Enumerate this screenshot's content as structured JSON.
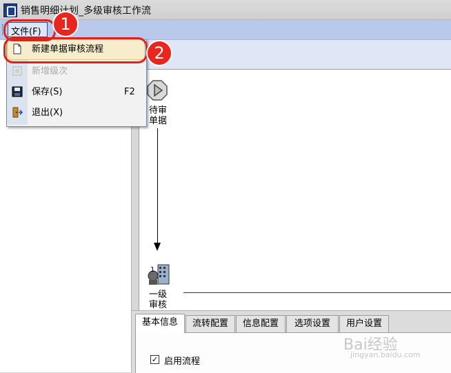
{
  "window": {
    "title": "销售明细计划_多级审核工作流"
  },
  "menubar": {
    "file_label": "文件(F)"
  },
  "file_menu": {
    "items": [
      {
        "label": "新建单据审核流程",
        "shortcut": "",
        "icon": "new-document-icon",
        "enabled": true,
        "highlighted": true
      },
      {
        "label": "新增级次",
        "shortcut": "",
        "icon": "add-level-icon",
        "enabled": false,
        "highlighted": false
      },
      {
        "label": "保存(S)",
        "shortcut": "F2",
        "icon": "save-disk-icon",
        "enabled": true,
        "highlighted": false
      },
      {
        "label": "退出(X)",
        "shortcut": "",
        "icon": "exit-door-icon",
        "enabled": true,
        "highlighted": false
      }
    ]
  },
  "workflow": {
    "nodes": [
      {
        "label_line1": "待审",
        "label_line2": "单据"
      },
      {
        "label_line1": "一级",
        "label_line2": "审核"
      }
    ]
  },
  "tabs": [
    {
      "label": "基本信息",
      "active": true
    },
    {
      "label": "流转配置",
      "active": false
    },
    {
      "label": "信息配置",
      "active": false
    },
    {
      "label": "选项设置",
      "active": false
    },
    {
      "label": "用户设置",
      "active": false
    }
  ],
  "settings": {
    "enable_flow_label": "启用流程",
    "enable_flow_checked": true
  },
  "annotations": {
    "step1": "1",
    "step2": "2"
  },
  "watermark": {
    "text": "Bai经验",
    "sub": "jingyan.baidu.com"
  },
  "colors": {
    "menubar": "#b9c9ec",
    "highlight": "#f7eccb",
    "annotation": "#e2201c"
  }
}
